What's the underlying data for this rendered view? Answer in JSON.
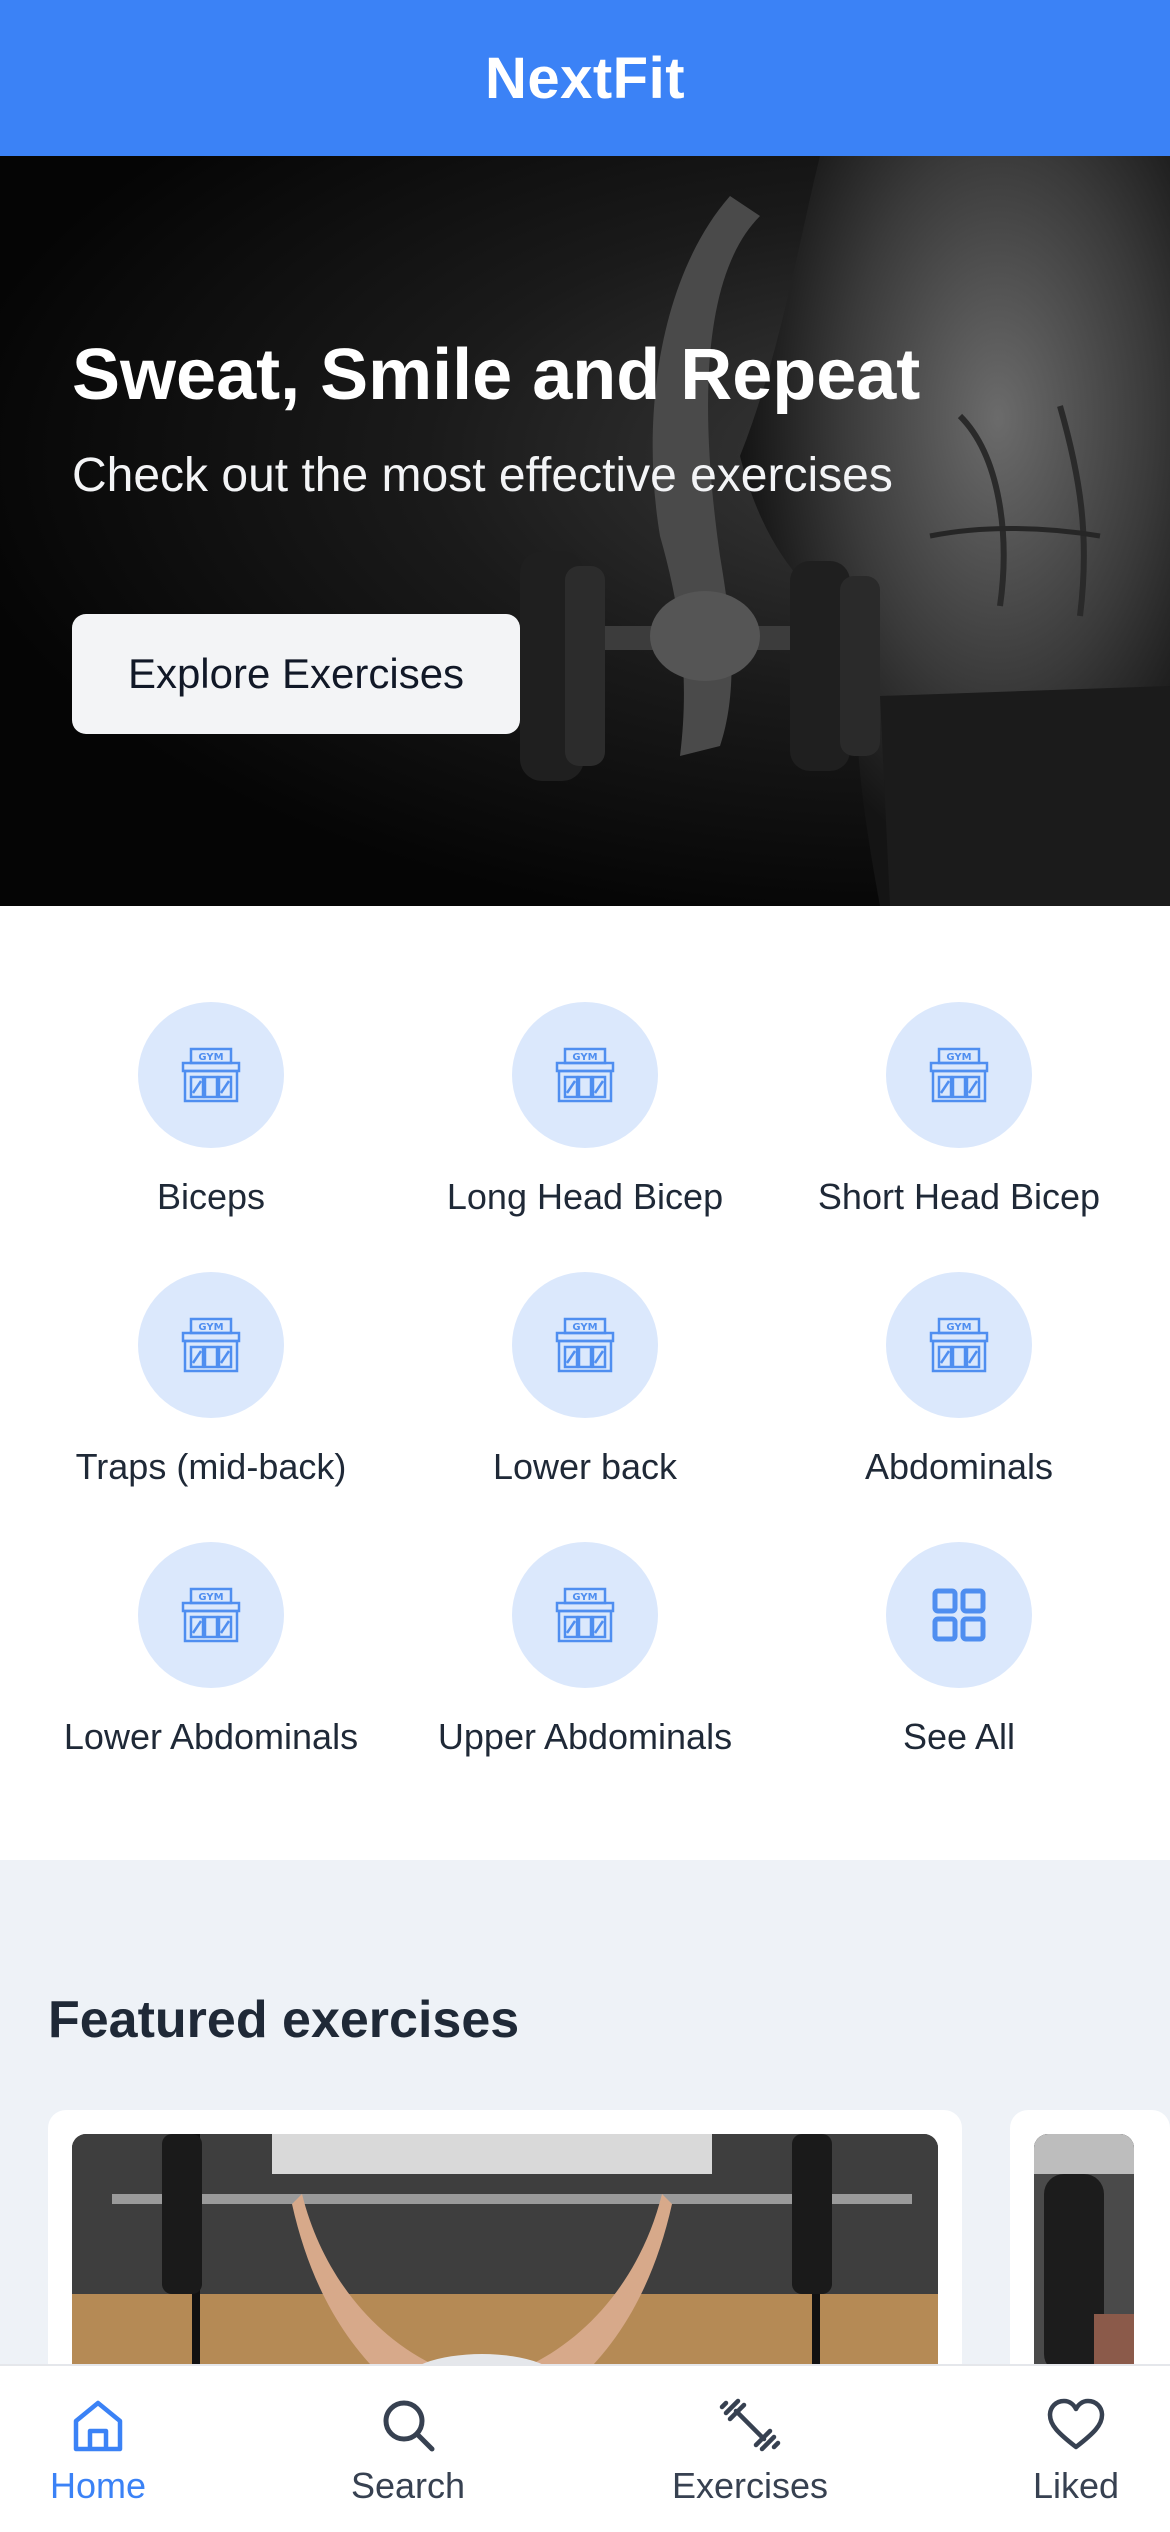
{
  "header": {
    "title": "NextFit",
    "color": "#3b82f6"
  },
  "hero": {
    "title": "Sweat, Smile and Repeat",
    "subtitle": "Check out the most effective exercises",
    "button_label": "Explore Exercises"
  },
  "categories": {
    "items": [
      {
        "label": "Biceps",
        "icon": "gym-icon"
      },
      {
        "label": "Long Head Bicep",
        "icon": "gym-icon"
      },
      {
        "label": "Short Head Bicep",
        "icon": "gym-icon"
      },
      {
        "label": "Traps (mid-back)",
        "icon": "gym-icon"
      },
      {
        "label": "Lower back",
        "icon": "gym-icon"
      },
      {
        "label": "Abdominals",
        "icon": "gym-icon"
      },
      {
        "label": "Lower Abdominals",
        "icon": "gym-icon"
      },
      {
        "label": "Upper Abdominals",
        "icon": "gym-icon"
      },
      {
        "label": "See All",
        "icon": "grid-icon"
      }
    ]
  },
  "featured": {
    "title": "Featured exercises"
  },
  "bottom_nav": {
    "items": [
      {
        "label": "Home",
        "icon": "home-icon",
        "active": true
      },
      {
        "label": "Search",
        "icon": "search-icon",
        "active": false
      },
      {
        "label": "Exercises",
        "icon": "dumbbell-icon",
        "active": false
      },
      {
        "label": "Liked",
        "icon": "heart-icon",
        "active": false
      }
    ]
  }
}
